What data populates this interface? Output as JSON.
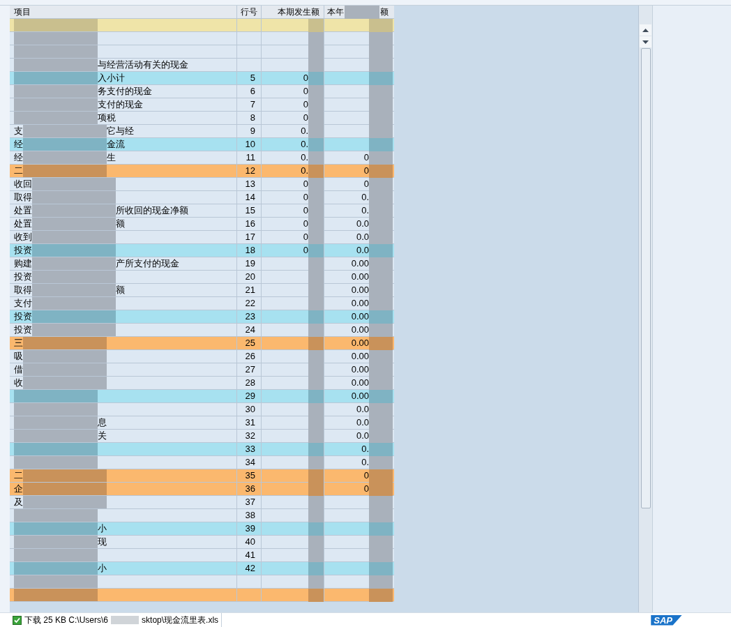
{
  "table": {
    "columns": [
      {
        "label": "项目"
      },
      {
        "label": "行号"
      },
      {
        "label": "本期发生额"
      },
      {
        "label_start": "本年",
        "label_end": "额"
      }
    ],
    "rows": [
      {
        "kind": "header"
      },
      {
        "kind": "normal"
      },
      {
        "kind": "normal"
      },
      {
        "kind": "normal",
        "item_end": "与经营活动有关的现金"
      },
      {
        "kind": "subtotal",
        "item_end": "入小计",
        "line": "5",
        "current": "0"
      },
      {
        "kind": "normal",
        "item_end": "务支付的现金",
        "line": "6",
        "current": "0"
      },
      {
        "kind": "normal",
        "item_end": "支付的现金",
        "line": "7",
        "current": "0"
      },
      {
        "kind": "normal",
        "item_end": "项税",
        "line": "8",
        "current": "0"
      },
      {
        "kind": "normal",
        "item_start": "支",
        "item_end": "它与经",
        "line": "9",
        "current": "0."
      },
      {
        "kind": "subtotal",
        "item_start": "经",
        "item_end": "金流",
        "line": "10",
        "current": "0."
      },
      {
        "kind": "normal",
        "item_start": "经",
        "item_end": "生",
        "line": "11",
        "current": "0.",
        "ytd": "0"
      },
      {
        "kind": "section",
        "item_start": "二",
        "line": "12",
        "current": "0.",
        "ytd": "0"
      },
      {
        "kind": "normal",
        "item_start": "收回",
        "line": "13",
        "current": "0",
        "ytd": "0"
      },
      {
        "kind": "normal",
        "item_start": "取得",
        "line": "14",
        "current": "0",
        "ytd": "0."
      },
      {
        "kind": "normal",
        "item_start": "处置",
        "item_end": "所收回的现金净额",
        "line": "15",
        "current": "0",
        "ytd": "0."
      },
      {
        "kind": "normal",
        "item_start": "处置",
        "item_end": "额",
        "line": "16",
        "current": "0",
        "ytd": "0.0"
      },
      {
        "kind": "normal",
        "item_start": "收到",
        "line": "17",
        "current": "0",
        "ytd": "0.0"
      },
      {
        "kind": "subtotal",
        "item_start": "投资",
        "line": "18",
        "current": "0",
        "ytd": "0.0"
      },
      {
        "kind": "normal",
        "item_start": "购建",
        "item_end": "产所支付的现金",
        "line": "19",
        "ytd": "0.00"
      },
      {
        "kind": "normal",
        "item_start": "投资",
        "line": "20",
        "ytd": "0.00"
      },
      {
        "kind": "normal",
        "item_start": "取得",
        "item_end": "额",
        "line": "21",
        "ytd": "0.00"
      },
      {
        "kind": "normal",
        "item_start": "支付",
        "line": "22",
        "ytd": "0.00"
      },
      {
        "kind": "subtotal",
        "item_start": "投资",
        "line": "23",
        "ytd": "0.00"
      },
      {
        "kind": "normal",
        "item_start": "投资",
        "line": "24",
        "ytd": "0.00"
      },
      {
        "kind": "section",
        "item_start": "三",
        "line": "25",
        "ytd": "0.00"
      },
      {
        "kind": "normal",
        "item_start": "吸",
        "line": "26",
        "ytd": "0.00"
      },
      {
        "kind": "normal",
        "item_start": "借",
        "line": "27",
        "ytd": "0.00"
      },
      {
        "kind": "normal",
        "item_start": "收",
        "line": "28",
        "ytd": "0.00"
      },
      {
        "kind": "subtotal",
        "line": "29",
        "ytd": "0.00"
      },
      {
        "kind": "normal",
        "line": "30",
        "ytd": "0.0"
      },
      {
        "kind": "normal",
        "item_end": "息",
        "line": "31",
        "ytd": "0.0"
      },
      {
        "kind": "normal",
        "item_end": "关",
        "line": "32",
        "ytd": "0.0"
      },
      {
        "kind": "subtotal",
        "line": "33",
        "ytd": "0."
      },
      {
        "kind": "normal",
        "line": "34",
        "ytd": "0."
      },
      {
        "kind": "section",
        "item_start": "二",
        "line": "35",
        "ytd": "0"
      },
      {
        "kind": "section",
        "item_start": "企",
        "line": "36",
        "ytd": "0"
      },
      {
        "kind": "normal",
        "item_start": "及",
        "line": "37"
      },
      {
        "kind": "normal",
        "line": "38"
      },
      {
        "kind": "subtotal",
        "item_end": "小",
        "line": "39"
      },
      {
        "kind": "normal",
        "item_end": "现",
        "line": "40"
      },
      {
        "kind": "normal",
        "line": "41"
      },
      {
        "kind": "subtotal",
        "item_end": "小",
        "line": "42"
      },
      {
        "kind": "normal"
      },
      {
        "kind": "section"
      }
    ]
  },
  "status_bar": {
    "message_start": "下载 25 KB C:\\Users\\6",
    "message_end": "sktop\\现金流里表.xls",
    "logo": "SAP"
  }
}
